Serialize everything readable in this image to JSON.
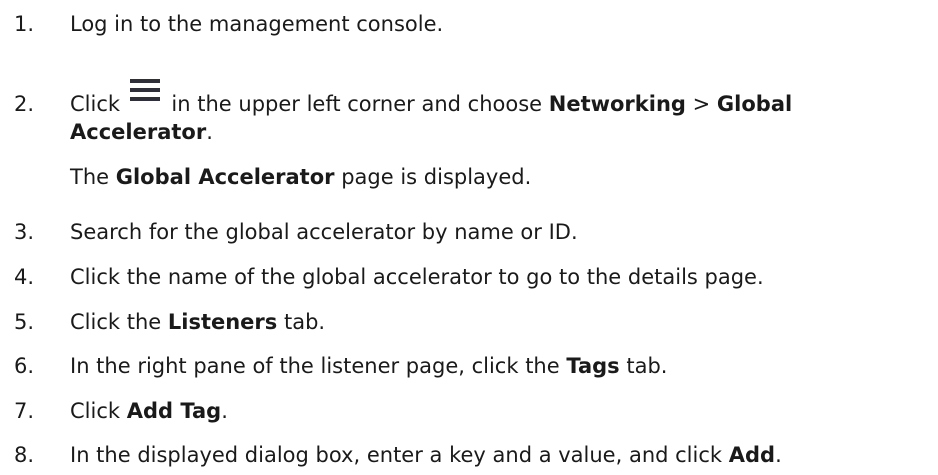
{
  "steps": [
    {
      "number": "1.",
      "text": "Log in to the management console."
    },
    {
      "number": "2.",
      "prefix": "Click",
      "icon": "menu-hamburger-icon",
      "middle": "in the upper left corner and choose",
      "bold1": "Networking",
      "sep": ">",
      "bold2a": "Global",
      "bold2b": "Accelerator",
      "suffix": ".",
      "result_bold": "Global Accelerator",
      "result_rest": "page is displayed.",
      "result_the": "The"
    },
    {
      "number": "3.",
      "text": "Search for the global accelerator by name or ID."
    },
    {
      "number": "4.",
      "text": "Click the name of the global accelerator to go to the details page."
    },
    {
      "number": "5.",
      "prefix": "Click the",
      "bold": "Listeners",
      "suffix": "tab."
    },
    {
      "number": "6.",
      "prefix": "In the right pane of the listener page, click the",
      "bold": "Tags",
      "suffix": "tab."
    },
    {
      "number": "7.",
      "prefix": "Click",
      "bold": "Add Tag",
      "suffix": "."
    },
    {
      "number": "8.",
      "prefix": "In the displayed dialog box, enter a key and a value, and click",
      "bold": "Add",
      "suffix": "."
    }
  ],
  "colors": {
    "text": "#1a1a1a",
    "icon": "#2f2f3a"
  }
}
